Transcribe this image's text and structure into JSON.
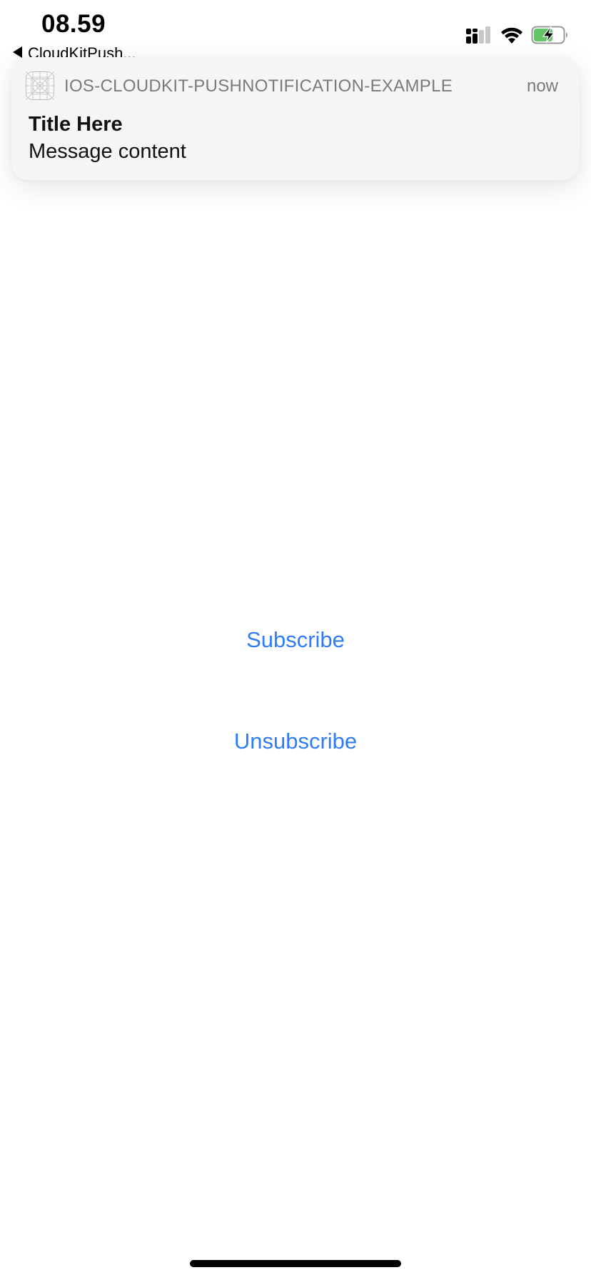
{
  "status_bar": {
    "time": "08.59",
    "back_label": "CloudKitPush...",
    "icons": [
      "cellular-signal-icon",
      "wifi-icon",
      "battery-charging-icon"
    ],
    "battery_color": "#65c466"
  },
  "notification": {
    "app_icon": "app-placeholder-icon",
    "app_name": "IOS-CLOUDKIT-PUSHNOTIFICATION-EXAMPLE",
    "time": "now",
    "title": "Title Here",
    "message": "Message content"
  },
  "main": {
    "subscribe_label": "Subscribe",
    "unsubscribe_label": "Unsubscribe",
    "accent_color": "#2f7cf6"
  }
}
